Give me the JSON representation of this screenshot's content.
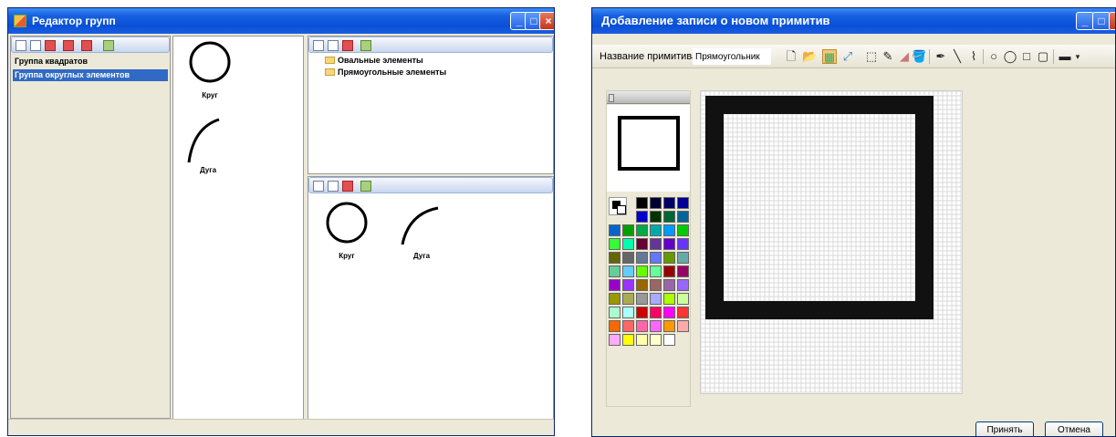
{
  "left_window": {
    "title": "Редактор групп",
    "groups": [
      {
        "label": "Группа квадратов",
        "selected": false
      },
      {
        "label": "Группа округлых элементов",
        "selected": true
      }
    ],
    "shapes": [
      {
        "label": "Круг",
        "icon": "circle-shape"
      },
      {
        "label": "Дуга",
        "icon": "arc-shape"
      }
    ],
    "folders": [
      "Овальные элементы",
      "Прямоугольные элементы"
    ],
    "group_shapes": [
      {
        "label": "Круг",
        "icon": "circle-shape"
      },
      {
        "label": "Дуга",
        "icon": "arc-shape"
      }
    ]
  },
  "right_window": {
    "title": "Добавление записи о новом примитив",
    "name_label": "Название примитива:",
    "name_value": "Прямоугольник",
    "tools": [
      "new-icon",
      "open-icon",
      "grid-icon",
      "select-icon",
      "rect-select-icon",
      "pencil-icon",
      "eraser-icon",
      "fill-icon",
      "pen-icon",
      "line-icon",
      "curve-icon",
      "ellipse-outline-icon",
      "ellipse-fill-icon",
      "rect-outline-icon",
      "rect-fill-icon",
      "line-width-icon"
    ],
    "palette": [
      "#000000",
      "#000033",
      "#000066",
      "#000099",
      "#0000cc",
      "#003300",
      "#006633",
      "#006699",
      "#0066cc",
      "#00a000",
      "#00aa44",
      "#00aaaa",
      "#0099ff",
      "#00cc00",
      "#33ff33",
      "#00ffaa",
      "#660033",
      "#663399",
      "#6600cc",
      "#6633ff",
      "#666600",
      "#666666",
      "#667799",
      "#6677ff",
      "#669900",
      "#66aaaa",
      "#66cc99",
      "#66ccff",
      "#66ff00",
      "#66ff99",
      "#990000",
      "#990066",
      "#9900cc",
      "#9933ff",
      "#996600",
      "#996666",
      "#9966aa",
      "#9966ff",
      "#999900",
      "#aaaa55",
      "#999999",
      "#aaaaff",
      "#aaff00",
      "#ccff99",
      "#aaffcc",
      "#aaffff",
      "#cc0000",
      "#ff0066",
      "#ff00ff",
      "#ff3333",
      "#ff6600",
      "#ff6666",
      "#ff66aa",
      "#ff66ff",
      "#ff9900",
      "#ffaaaa",
      "#ffaaff",
      "#ffff00",
      "#ffffaa",
      "#ffffcc",
      "#ffffff"
    ],
    "accept_label": "Принять",
    "cancel_label": "Отмена"
  }
}
